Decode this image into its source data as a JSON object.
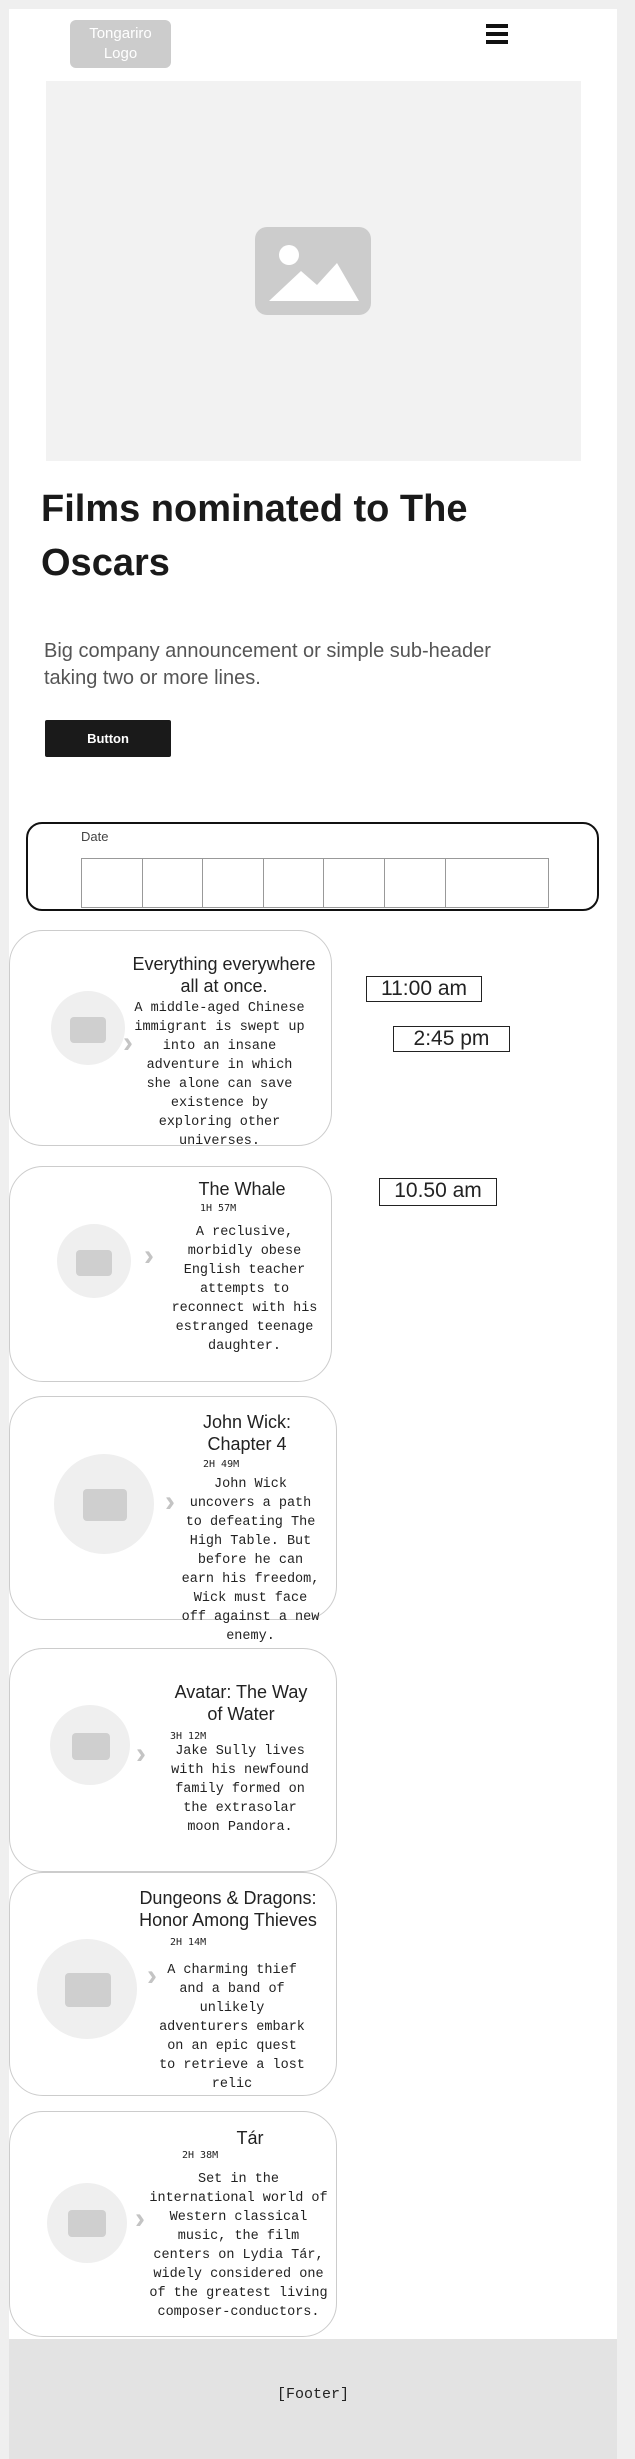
{
  "header": {
    "logo_text": "Tongariro Logo",
    "menu_icon": "hamburger-icon"
  },
  "hero": {
    "image_icon": "image-placeholder-icon"
  },
  "title": "Films nominated to The Oscars",
  "subheader": "Big company announcement or simple sub-header taking two or more lines.",
  "cta_label": "Button",
  "date_picker": {
    "label": "Date"
  },
  "times": [
    "11:00 am",
    "2:45 pm",
    "10.50 am"
  ],
  "films": [
    {
      "title": "Everything everywhere all at once.",
      "duration": "",
      "description": "A middle-aged Chinese immigrant is swept up into an insane adventure in which she alone can save existence by exploring other universes."
    },
    {
      "title": "The Whale",
      "duration": "1H 57M",
      "description": "A reclusive, morbidly obese English teacher attempts to reconnect with his estranged teenage daughter."
    },
    {
      "title": "John Wick: Chapter 4",
      "duration": "2H 49M",
      "description": "John Wick uncovers a path to defeating The High Table. But before he can earn his freedom, Wick must face off against a new enemy."
    },
    {
      "title": "Avatar: The Way of Water",
      "duration": "3H 12M",
      "description": "Jake Sully lives with his newfound family formed on the extrasolar moon Pandora."
    },
    {
      "title": "Dungeons & Dragons: Honor Among Thieves",
      "duration": "2H 14M",
      "description": "A charming thief and a band of unlikely adventurers embark on an epic quest to retrieve a lost relic"
    },
    {
      "title": "Tár",
      "duration": "2H 38M",
      "description": "Set in the international world of Western classical music, the film centers on Lydia Tár, widely considered one of the greatest living composer-conductors."
    }
  ],
  "footer": "[Footer]"
}
